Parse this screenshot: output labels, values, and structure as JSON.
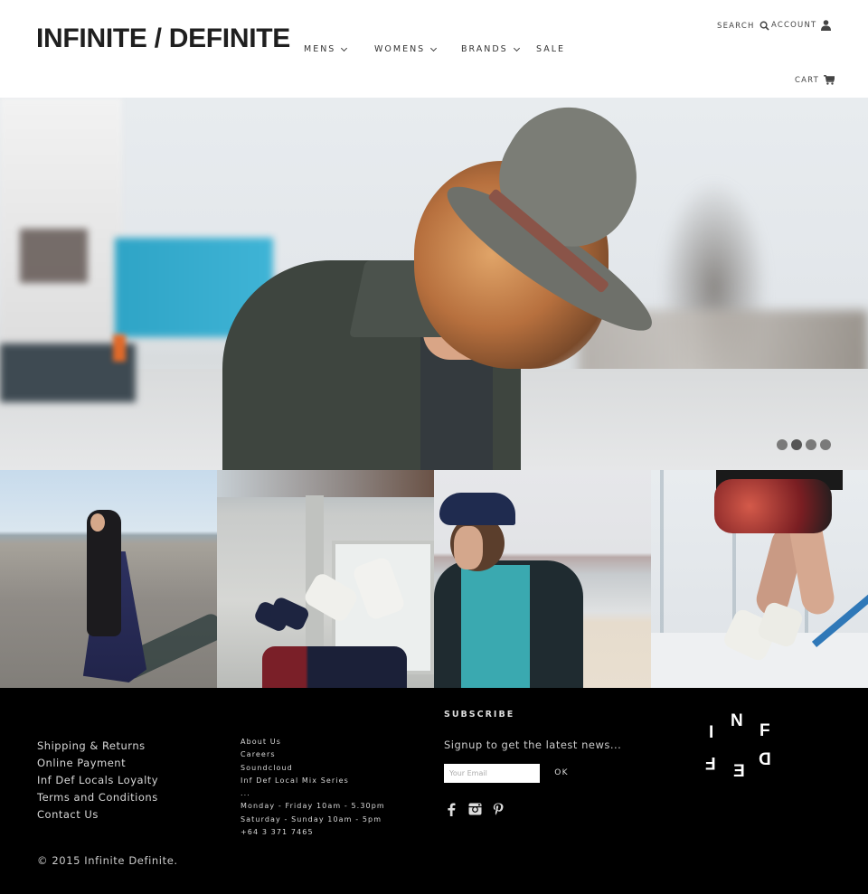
{
  "header": {
    "logo": "INFINITE / DEFINITE",
    "nav": [
      {
        "label": "MENS",
        "has_dropdown": true
      },
      {
        "label": "WOMENS",
        "has_dropdown": true
      },
      {
        "label": "BRANDS",
        "has_dropdown": true
      },
      {
        "label": "SALE",
        "has_dropdown": false
      }
    ],
    "utility": {
      "search_label": "SEARCH",
      "search_icon": "search-icon",
      "account_label": "ACCOUNT",
      "account_icon": "user-icon",
      "cart_label": "CART",
      "cart_icon": "cart-icon"
    }
  },
  "hero": {
    "image_description": "Man in a grey felt hat with a leather band and long highlighted hair, looking down, wearing a dark olive corduroy shirt; blurred city street background with a blue building",
    "slider": {
      "total_slides": 4,
      "active_slide": 2
    }
  },
  "tiles": [
    {
      "image_description": "Woman with long dark hair in a navy maxi dress on a sandy beach"
    },
    {
      "image_description": "Two pairs of legs in the air wearing white and navy high-top sneakers with red socks"
    },
    {
      "image_description": "Young man in a navy cap, teal tee and dark jacket by a lakeshore"
    },
    {
      "image_description": "Tattooed man jumping in patterned shorts and white sneakers near a metal structure"
    }
  ],
  "footer": {
    "links": [
      "Shipping & Returns",
      "Online Payment",
      "Inf Def Locals Loyalty",
      "Terms and Conditions",
      "Contact Us"
    ],
    "info": {
      "links": [
        "About Us",
        "Careers",
        "Soundcloud",
        "Inf Def Local Mix Series"
      ],
      "separator": "...",
      "hours": [
        "Monday - Friday 10am - 5.30pm",
        "Saturday - Sunday 10am - 5pm"
      ],
      "phone": "+64 3 371 7465"
    },
    "subscribe": {
      "title": "SUBSCRIBE",
      "text": "Signup to get the latest news...",
      "email_placeholder": "Your Email",
      "email_value": "",
      "button_label": "OK",
      "social": [
        "facebook-icon",
        "instagram-icon",
        "pinterest-icon"
      ]
    },
    "mark_letters": [
      "I",
      "N",
      "F",
      "D",
      "E",
      "F"
    ],
    "copyright": "© 2015 Infinite Definite."
  },
  "colors": {
    "header_bg": "#ffffff",
    "footer_bg": "#000000",
    "text_dark": "#1f1f1f",
    "dot_inactive": "#7a7a7a",
    "dot_active": "#555555"
  }
}
